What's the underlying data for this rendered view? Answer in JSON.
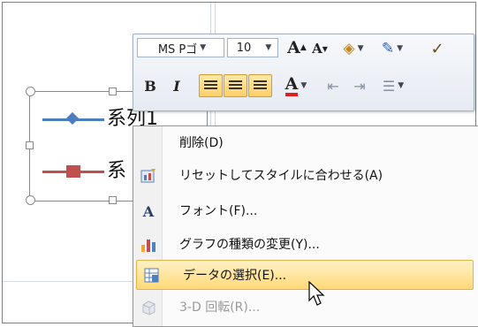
{
  "legend": {
    "items": [
      {
        "label": "系列1",
        "color": "#4a7ec0",
        "marker": "diamond"
      },
      {
        "label": "系",
        "color": "#c0504d",
        "marker": "square"
      }
    ]
  },
  "minitoolbar": {
    "font_name": "MS Pゴ",
    "font_size": "10",
    "bold": "B",
    "italic": "I",
    "font_color_label": "A",
    "grow_font": "A",
    "shrink_font": "A"
  },
  "context_menu": {
    "items": [
      {
        "label": "削除(D)",
        "icon": "none",
        "enabled": true,
        "highlighted": false
      },
      {
        "label": "リセットしてスタイルに合わせる(A)",
        "icon": "reset-style-icon",
        "enabled": true,
        "highlighted": false
      },
      {
        "label": "フォント(F)...",
        "icon": "font-icon",
        "enabled": true,
        "highlighted": false
      },
      {
        "label": "グラフの種類の変更(Y)...",
        "icon": "chart-type-icon",
        "enabled": true,
        "highlighted": false
      },
      {
        "label": "データの選択(E)...",
        "icon": "select-data-icon",
        "enabled": true,
        "highlighted": true
      },
      {
        "label": "3-D 回転(R)...",
        "icon": "rotate-3d-icon",
        "enabled": false,
        "highlighted": false
      }
    ]
  },
  "colors": {
    "highlight": "#ffd978",
    "font_color_underline": "#e01e1e"
  }
}
